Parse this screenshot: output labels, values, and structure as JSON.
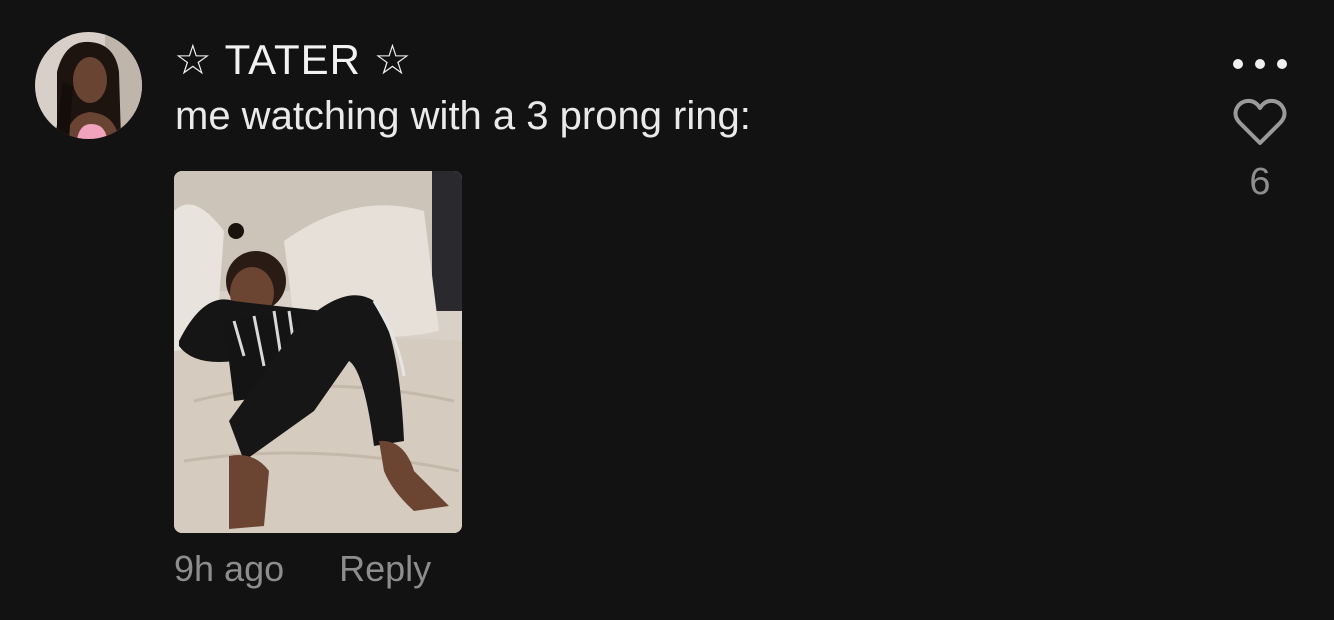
{
  "comment": {
    "username": "☆ TATER ☆",
    "text": "me watching with a 3 prong ring:",
    "time": "9h ago",
    "reply_label": "Reply",
    "like_count": "6",
    "liked": false
  },
  "icons": {
    "more": "more-options-icon",
    "like": "heart-outline-icon"
  },
  "colors": {
    "background": "#121212",
    "text_primary": "#eaeaea",
    "text_secondary": "#8d8d8d"
  }
}
